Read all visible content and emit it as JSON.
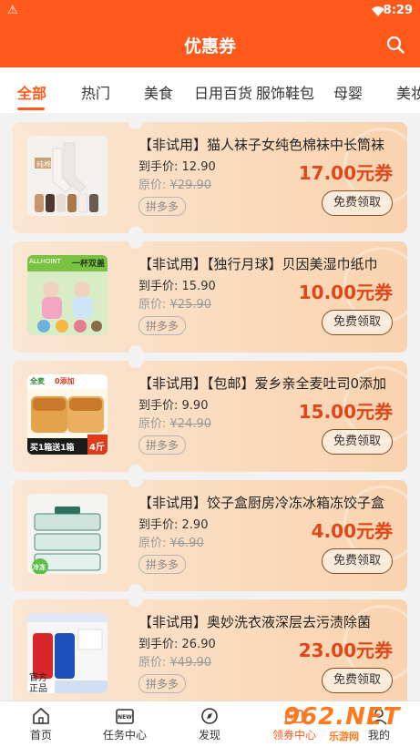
{
  "status_bar": {
    "time": "8:29"
  },
  "header": {
    "title": "优惠券"
  },
  "tabs": [
    "全部",
    "热门",
    "美食",
    "日用百货",
    "服饰鞋包",
    "母婴",
    "美妆"
  ],
  "price_label": "到手价:",
  "orig_label": "原价:",
  "claim_label": "免费领取",
  "coupons": [
    {
      "title": "【非试用】猫人袜子女纯色棉袜中长筒袜",
      "price": "12.90",
      "original": "¥29.90",
      "platform": "拼多多",
      "coupon": "17.00元券"
    },
    {
      "title": "【非试用】【独行月球】贝因美湿巾纸巾",
      "price": "15.90",
      "original": "¥25.90",
      "platform": "拼多多",
      "coupon": "10.00元券"
    },
    {
      "title": "【非试用】【包邮】爱乡亲全麦吐司0添加",
      "price": "9.90",
      "original": "¥24.90",
      "platform": "拼多多",
      "coupon": "15.00元券"
    },
    {
      "title": "【非试用】饺子盒厨房冷冻冰箱冻饺子盒",
      "price": "2.90",
      "original": "¥6.90",
      "platform": "拼多多",
      "coupon": "4.00元券"
    },
    {
      "title": "【非试用】奥妙洗衣液深层去污渍除菌",
      "price": "26.90",
      "original": "¥49.90",
      "platform": "拼多多",
      "coupon": "23.00元券"
    }
  ],
  "thumb_texts": {
    "t1": "纯棉",
    "t2a": "ALLHOINT",
    "t2b": "一杯双盖",
    "t3a": "全麦",
    "t3b": "0添加",
    "t3c": "买1箱送1箱",
    "t3d": "4斤",
    "t4": "冷冻",
    "t5a": "官方",
    "t5b": "正品"
  },
  "bottom_nav": [
    {
      "label": "首页",
      "icon": "home-icon"
    },
    {
      "label": "任务中心",
      "icon": "task-new-icon"
    },
    {
      "label": "发现",
      "icon": "compass-icon"
    },
    {
      "label": "领券中心",
      "icon": "coupon-icon"
    },
    {
      "label": "我的",
      "icon": "user-icon"
    }
  ],
  "watermark": {
    "big": "962.NET",
    "small": "乐游网"
  },
  "colors": {
    "brand": "#ff5a1c",
    "coupon_text": "#e0461a"
  }
}
